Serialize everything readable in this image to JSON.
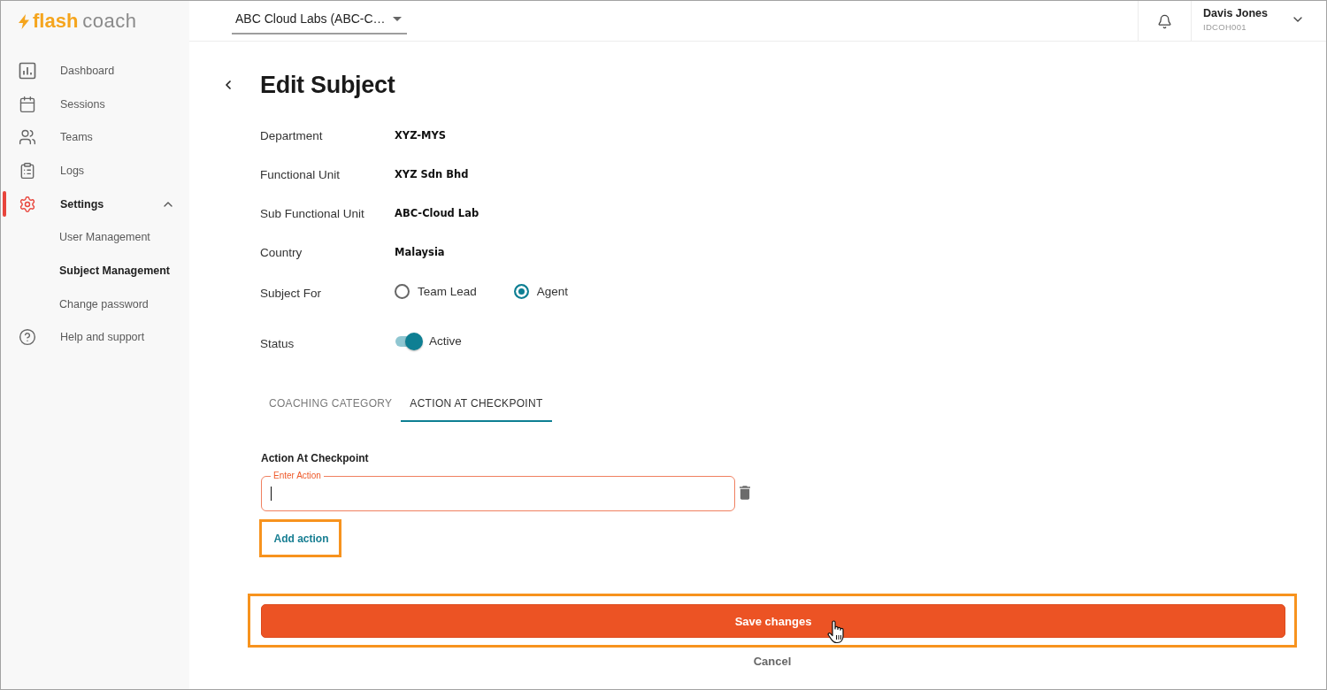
{
  "logo": {
    "bold": "flash",
    "light": "coach"
  },
  "header": {
    "organization": "ABC Cloud Labs (ABC-C…",
    "user": {
      "name": "Davis Jones",
      "id": "IDCOH001"
    }
  },
  "sidebar": {
    "items": [
      {
        "label": "Dashboard",
        "selected": false
      },
      {
        "label": "Sessions",
        "selected": false
      },
      {
        "label": "Teams",
        "selected": false
      },
      {
        "label": "Logs",
        "selected": false
      },
      {
        "label": "Settings",
        "selected": true,
        "expanded": true,
        "children": [
          {
            "label": "User Management",
            "selected": false
          },
          {
            "label": "Subject Management",
            "selected": true
          },
          {
            "label": "Change password",
            "selected": false
          }
        ]
      },
      {
        "label": "Help and support",
        "selected": false
      }
    ]
  },
  "page": {
    "title": "Edit Subject",
    "fields": [
      {
        "kind": "text",
        "label": "Department",
        "value": "XYZ-MYS"
      },
      {
        "kind": "text",
        "label": "Functional Unit",
        "value": "XYZ Sdn Bhd"
      },
      {
        "kind": "text",
        "label": "Sub Functional Unit",
        "value": "ABC-Cloud Lab"
      },
      {
        "kind": "text",
        "label": "Country",
        "value": "Malaysia"
      },
      {
        "kind": "radio",
        "label": "Subject For",
        "options": [
          {
            "label": "Team Lead",
            "selected": false
          },
          {
            "label": "Agent",
            "selected": true
          }
        ]
      },
      {
        "kind": "toggle",
        "label": "Status",
        "on": true,
        "value": "Active"
      }
    ],
    "tabs": [
      {
        "label": "COACHING CATEGORY",
        "selected": false
      },
      {
        "label": "ACTION AT CHECKPOINT",
        "selected": true
      }
    ],
    "action_section": {
      "heading": "Action At Checkpoint",
      "actions": [
        {
          "label": "Enter Action",
          "focused": true
        }
      ],
      "add_button": {
        "label": "Add action",
        "highlighted": true
      }
    },
    "save_button": {
      "label": "Save changes",
      "highlighted": true
    },
    "cancel_button": {
      "label": "Cancel"
    }
  }
}
